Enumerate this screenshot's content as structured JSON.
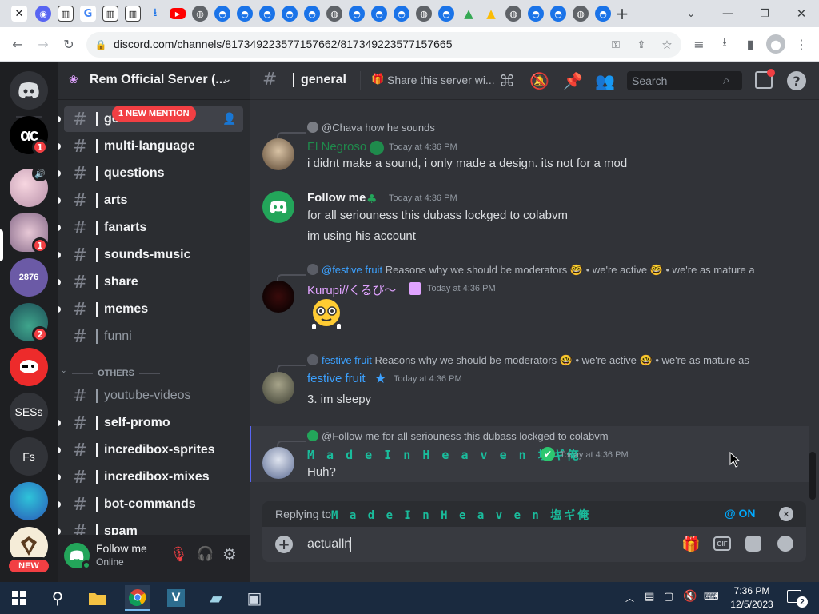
{
  "browser": {
    "url": "discord.com/channels/817349223577157662/817349223577157665",
    "tab_icons": [
      "discord-icon",
      "book-icon",
      "google-icon",
      "book-icon",
      "book-icon",
      "download-icon",
      "youtube-icon",
      "globe-icon",
      "discord-icon",
      "discord-icon",
      "discord-icon",
      "discord-icon",
      "globe-icon",
      "discord-icon",
      "discord-icon",
      "globe-icon",
      "discord-icon",
      "drive-icon",
      "drive-icon",
      "globe-icon",
      "discord-icon",
      "discord-icon",
      "globe-icon",
      "discord-icon"
    ],
    "close_tab": "✕",
    "new_tab": "+"
  },
  "guilds": {
    "badges": [
      "1",
      "1",
      "2"
    ],
    "labels": {
      "sess": "SESs",
      "fs": "Fs",
      "num": "2876"
    },
    "new_badge": "NEW"
  },
  "server": {
    "name": "Rem Official Server (..."
  },
  "mention_banner": "1 NEW MENTION",
  "channels": [
    {
      "name": "general",
      "muted": false
    },
    {
      "name": "multi-language",
      "muted": false
    },
    {
      "name": "questions",
      "muted": false
    },
    {
      "name": "arts",
      "muted": false
    },
    {
      "name": "fanarts",
      "muted": false
    },
    {
      "name": "sounds-music",
      "muted": false
    },
    {
      "name": "share",
      "muted": false
    },
    {
      "name": "memes",
      "muted": false
    },
    {
      "name": "funni",
      "muted": true
    }
  ],
  "category_others": "OTHERS",
  "channels_others": [
    {
      "name": "youtube-videos",
      "muted": true
    },
    {
      "name": "self-promo",
      "muted": false
    },
    {
      "name": "incredibox-sprites",
      "muted": false
    },
    {
      "name": "incredibox-mixes",
      "muted": false
    },
    {
      "name": "bot-commands",
      "muted": false
    },
    {
      "name": "spam",
      "muted": false
    }
  ],
  "user": {
    "name": "Follow me",
    "status": "Online"
  },
  "header": {
    "channel": "general",
    "topic": "Share this server wi...",
    "search_placeholder": "Search"
  },
  "messages": {
    "m1": {
      "reply_author": "@Chava",
      "reply_text": "how he sounds",
      "author": "El Negroso",
      "time": "Today at 4:36 PM",
      "text": "i didnt make a sound, i only made a design. its not for a mod"
    },
    "m2": {
      "author": "Follow me",
      "time": "Today at 4:36 PM",
      "line1": "for all seriouness this dubass lockged to colabvm",
      "line2": "im using his account"
    },
    "m3": {
      "reply_author": "@festive fruit",
      "reply_text": "Reasons why we should be moderators 🤓 • we're active 🤓  • we're as mature a",
      "author": "Kurupi//くるぴ〜",
      "time": "Today at 4:36 PM"
    },
    "m4": {
      "reply_author": "festive fruit",
      "reply_text": "Reasons why we should be moderators 🤓 • we're active 🤓  • we're as mature as",
      "author": "festive fruit",
      "time": "Today at 4:36 PM",
      "text": "3. im sleepy"
    },
    "m5": {
      "reply_author": "@Follow me",
      "reply_text": "for all seriouness this dubass lockged to colabvm",
      "author": "M a d e   I n   H e a v e n   塩ギ俺",
      "time": "Today at 4:36 PM",
      "text": "Huh?"
    }
  },
  "composer": {
    "replying_prefix": "Replying to",
    "replying_to": "M a d e   I n   H e a v e n   塩ギ俺",
    "mention_toggle": "@ ON",
    "value": "actualln"
  },
  "taskbar": {
    "time": "7:36 PM",
    "date": "12/5/2023",
    "notifications": "2"
  },
  "colors": {
    "teal_name": "#1abc9c",
    "green_name": "#2dc770",
    "pink_name": "#e0a3ff",
    "blue_name": "#3ca1ff",
    "brand": "#5865f2",
    "red": "#f23f43"
  }
}
